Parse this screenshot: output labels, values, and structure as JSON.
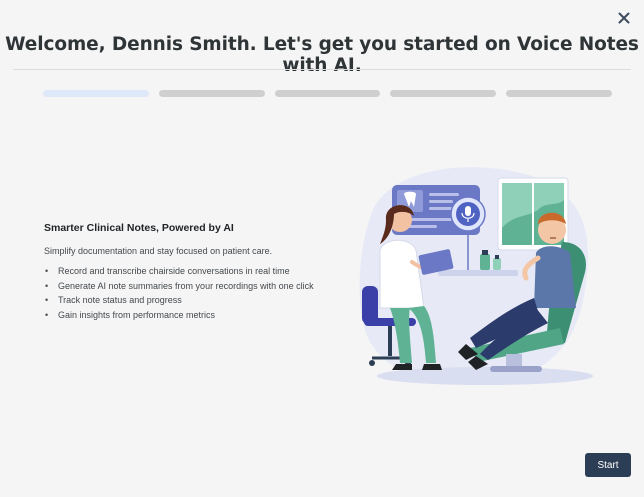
{
  "dialog": {
    "title": "Welcome, Dennis Smith. Let's get you started on Voice Notes with AI.",
    "close_icon": "close-icon",
    "progress": {
      "total_steps": 5,
      "current_step": 1
    },
    "headline": "Smarter Clinical Notes, Powered by AI",
    "subtitle": "Simplify documentation and stay focused on patient care.",
    "features": [
      "Record and transcribe chairside conversations in real time",
      "Generate AI note summaries from your recordings with one click",
      "Track note status and progress",
      "Gain insights from performance metrics"
    ],
    "start_label": "Start"
  },
  "colors": {
    "accent": "#2c3e55",
    "close": "#3a4b5e",
    "progress_active": "#dde9f8",
    "progress_inactive": "#cfcfcf"
  }
}
